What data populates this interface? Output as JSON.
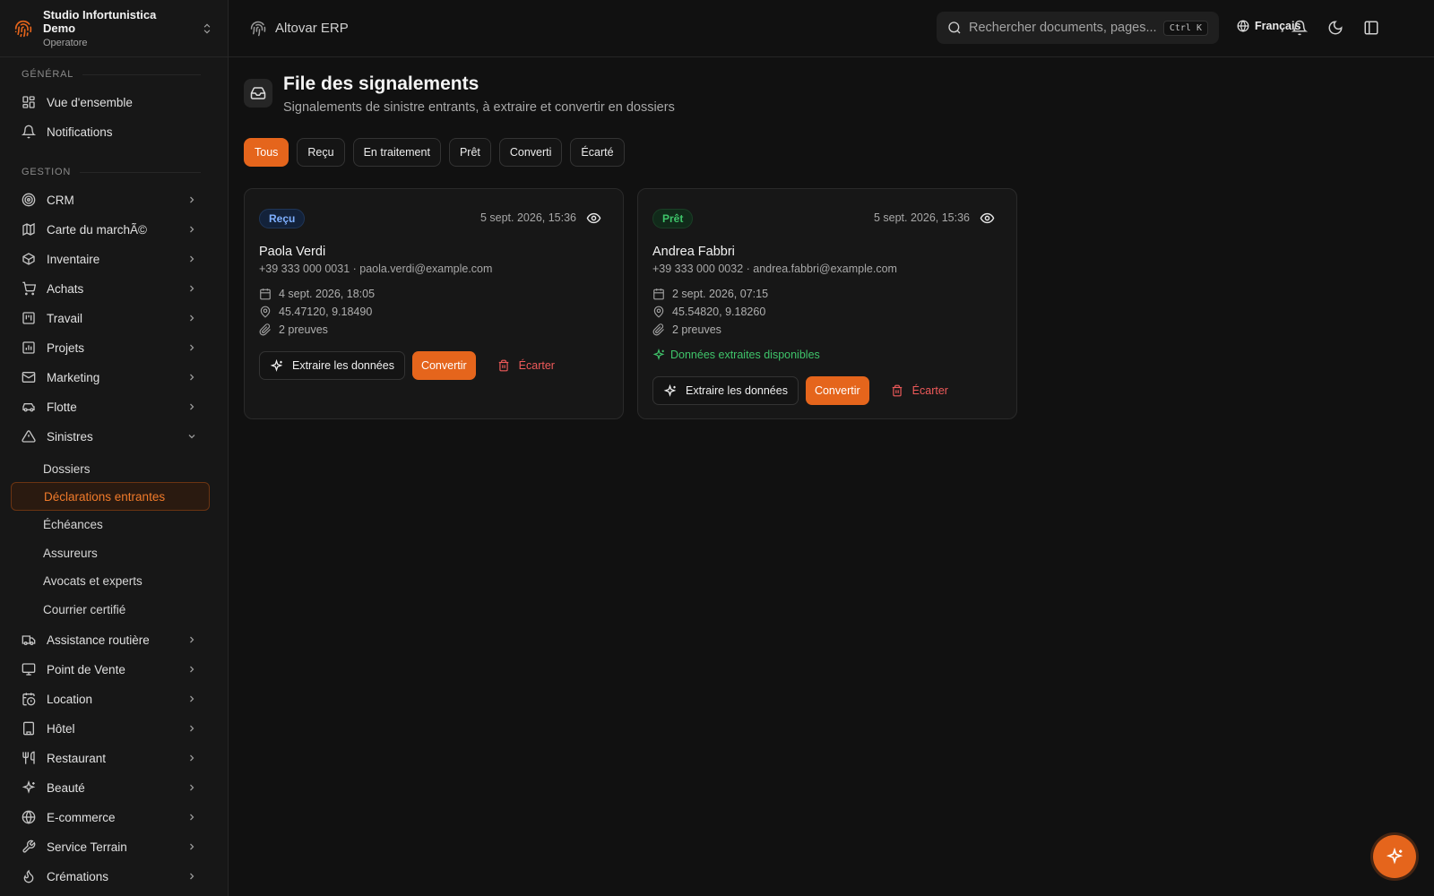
{
  "org": {
    "name": "Studio Infortunistica Demo",
    "role": "Operatore"
  },
  "sidebar": {
    "sections": [
      {
        "label": "GÉNÉRAL"
      },
      {
        "label": "GESTION"
      }
    ],
    "general_items": [
      {
        "label": "Vue d'ensemble",
        "icon": "dashboard-icon"
      },
      {
        "label": "Notifications",
        "icon": "bell-icon"
      }
    ],
    "gestion_items": [
      {
        "label": "CRM",
        "icon": "target-icon"
      },
      {
        "label": "Carte du marchÃ©",
        "icon": "map-icon"
      },
      {
        "label": "Inventaire",
        "icon": "package-icon"
      },
      {
        "label": "Achats",
        "icon": "cart-icon"
      },
      {
        "label": "Travail",
        "icon": "kanban-icon"
      },
      {
        "label": "Projets",
        "icon": "chart-icon"
      },
      {
        "label": "Marketing",
        "icon": "mail-icon"
      },
      {
        "label": "Flotte",
        "icon": "car-icon"
      },
      {
        "label": "Sinistres",
        "icon": "warning-icon"
      }
    ],
    "sinistres_sub": [
      {
        "label": "Dossiers"
      },
      {
        "label": "Déclarations entrantes"
      },
      {
        "label": "Échéances"
      },
      {
        "label": "Assureurs"
      },
      {
        "label": "Avocats et experts"
      },
      {
        "label": "Courrier certifié"
      }
    ],
    "more_items": [
      {
        "label": "Assistance routière",
        "icon": "truck-icon"
      },
      {
        "label": "Point de Vente",
        "icon": "monitor-icon"
      },
      {
        "label": "Location",
        "icon": "calendar-clock-icon"
      },
      {
        "label": "Hôtel",
        "icon": "building-icon"
      },
      {
        "label": "Restaurant",
        "icon": "utensils-icon"
      },
      {
        "label": "Beauté",
        "icon": "sparkles-icon"
      },
      {
        "label": "E-commerce",
        "icon": "globe-icon"
      },
      {
        "label": "Service Terrain",
        "icon": "wrench-icon"
      },
      {
        "label": "Crémations",
        "icon": "flame-icon"
      }
    ]
  },
  "topbar": {
    "app_title": "Altovar ERP",
    "search_placeholder": "Rechercher documents, pages...",
    "search_shortcut": "Ctrl K",
    "language": "Français"
  },
  "page": {
    "title": "File des signalements",
    "subtitle": "Signalements de sinistre entrants, à extraire et convertir en dossiers"
  },
  "filters": [
    "Tous",
    "Reçu",
    "En traitement",
    "Prêt",
    "Converti",
    "Écarté"
  ],
  "cards": [
    {
      "status": "Reçu",
      "received": "5 sept. 2026, 15:36",
      "name": "Paola Verdi",
      "contact": "+39 333 000 0031 · paola.verdi@example.com",
      "incident_date": "4 sept. 2026, 18:05",
      "coords": "45.47120, 9.18490",
      "evidence": "2 preuves",
      "extracted_note": ""
    },
    {
      "status": "Prêt",
      "received": "5 sept. 2026, 15:36",
      "name": "Andrea Fabbri",
      "contact": "+39 333 000 0032 · andrea.fabbri@example.com",
      "incident_date": "2 sept. 2026, 07:15",
      "coords": "45.54820, 9.18260",
      "evidence": "2 preuves",
      "extracted_note": "Données extraites disponibles"
    }
  ],
  "actions": {
    "extract": "Extraire les données",
    "convert": "Convertir",
    "discard": "Écarter"
  },
  "colors": {
    "accent": "#e5651c",
    "success": "#3fc46a",
    "danger": "#ef5a5a",
    "info": "#7fb0ff"
  }
}
